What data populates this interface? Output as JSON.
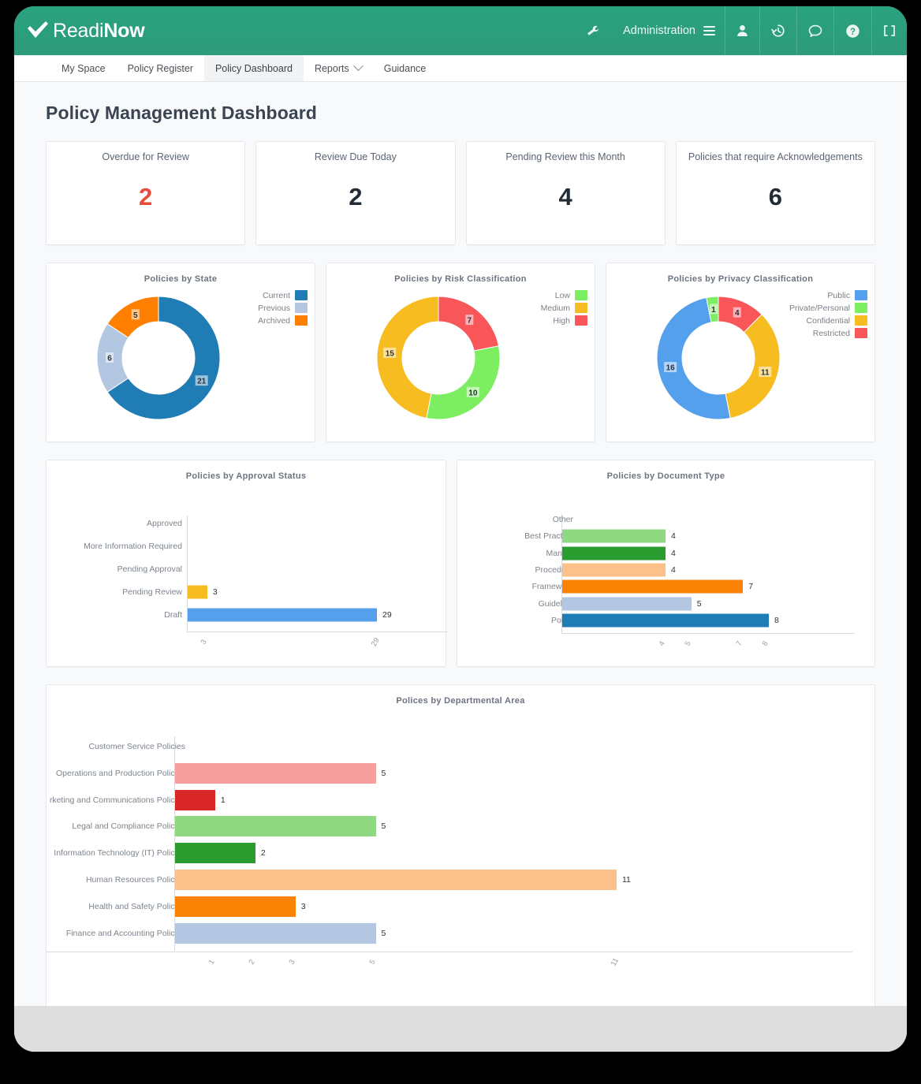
{
  "brand": {
    "name_part1": "Readi",
    "name_part2": "Now",
    "logo_icon": "check-mark-icon"
  },
  "topbar": {
    "wrench_icon": "wrench-icon",
    "admin_label": "Administration",
    "admin_menu_icon": "hamburger-menu-icon",
    "user_icon": "user-icon",
    "history_icon": "history-clock-icon",
    "chat_icon": "chat-bubble-icon",
    "help_icon": "help-circle-icon",
    "fullscreen_icon": "fullscreen-icon",
    "accent_color": "#2b9e7c"
  },
  "nav": {
    "tabs": [
      {
        "label": "My Space",
        "active": false,
        "has_caret": false
      },
      {
        "label": "Policy Register",
        "active": false,
        "has_caret": false
      },
      {
        "label": "Policy Dashboard",
        "active": true,
        "has_caret": false
      },
      {
        "label": "Reports",
        "active": false,
        "has_caret": true
      },
      {
        "label": "Guidance",
        "active": false,
        "has_caret": false
      }
    ]
  },
  "page": {
    "title": "Policy Management Dashboard"
  },
  "kpis": [
    {
      "label": "Overdue for Review",
      "value": "2",
      "alert": true
    },
    {
      "label": "Review Due Today",
      "value": "2",
      "alert": false
    },
    {
      "label": "Pending Review this Month",
      "value": "4",
      "alert": false
    },
    {
      "label": "Policies that require Acknowledgements",
      "value": "6",
      "alert": false
    }
  ],
  "chart_data": [
    {
      "type": "pie",
      "variant": "donut",
      "title": "Policies by State",
      "legend_position": "top-right",
      "categories": [
        "Current",
        "Previous",
        "Archived"
      ],
      "values": [
        21,
        6,
        5
      ],
      "colors": [
        "#1f7cb4",
        "#b3c7e2",
        "#ff8000"
      ],
      "total": 32,
      "data_labels": [
        "21",
        "6",
        "5"
      ]
    },
    {
      "type": "pie",
      "variant": "donut",
      "title": "Policies by Risk Classification",
      "legend_position": "top-right",
      "categories": [
        "Low",
        "Medium",
        "High"
      ],
      "values": [
        10,
        15,
        7
      ],
      "colors": [
        "#7ded61",
        "#f7bc20",
        "#f9565a"
      ],
      "total": 32,
      "data_labels": [
        "10",
        "15",
        "7"
      ]
    },
    {
      "type": "pie",
      "variant": "donut",
      "title": "Policies by Privacy Classification",
      "legend_position": "top-right",
      "categories": [
        "Public",
        "Private/Personal",
        "Confidential",
        "Restricted"
      ],
      "values": [
        16,
        1,
        11,
        4
      ],
      "colors": [
        "#54a0ec",
        "#7ded61",
        "#f7bc20",
        "#f9565a"
      ],
      "total": 32,
      "data_labels": [
        "16",
        "1",
        "11",
        "4"
      ]
    },
    {
      "type": "bar",
      "orientation": "horizontal",
      "title": "Policies by Approval Status",
      "categories": [
        "Approved",
        "More Information Required",
        "Pending Approval",
        "Pending Review",
        "Draft"
      ],
      "values": [
        0,
        0,
        0,
        3,
        29
      ],
      "colors": [
        "#54a0ec",
        "#54a0ec",
        "#54a0ec",
        "#f7bc20",
        "#54a0ec"
      ],
      "xlim": [
        0,
        29
      ],
      "xticks": [
        "3",
        "29"
      ],
      "xtick_rotated": true,
      "grid": false
    },
    {
      "type": "bar",
      "orientation": "horizontal",
      "title": "Policies by Document Type",
      "categories": [
        "Other",
        "Best Practice",
        "Manual",
        "Procedure",
        "Framework",
        "Guideline",
        "Policy"
      ],
      "values": [
        0,
        4,
        4,
        4,
        7,
        5,
        8
      ],
      "colors": [
        "#b3c7e2",
        "#8ed981",
        "#2a9c30",
        "#fcc08a",
        "#fa8204",
        "#b3c7e2",
        "#1f7cb4"
      ],
      "xlim": [
        0,
        8
      ],
      "xticks": [
        "4",
        "5",
        "7",
        "8"
      ],
      "xtick_rotated": true,
      "grid": false
    },
    {
      "type": "bar",
      "orientation": "horizontal",
      "title": "Polices by Departmental Area",
      "categories": [
        "Customer Service Policies",
        "Operations and Production Policies",
        "rketing and Communications Policies",
        "Legal and Compliance Policies",
        "Information Technology (IT) Policies",
        "Human Resources Policies",
        "Health and Safety Policies",
        "Finance and Accounting Policies"
      ],
      "values": [
        0,
        5,
        1,
        5,
        2,
        11,
        3,
        5
      ],
      "colors": [
        "#f79e9e",
        "#f79e9e",
        "#d92626",
        "#8ed981",
        "#2a9c30",
        "#fcc08a",
        "#fa8204",
        "#b3c7e2"
      ],
      "xlim": [
        0,
        11
      ],
      "xticks": [
        "1",
        "2",
        "3",
        "5",
        "11"
      ],
      "xtick_rotated": true,
      "grid": false
    }
  ]
}
